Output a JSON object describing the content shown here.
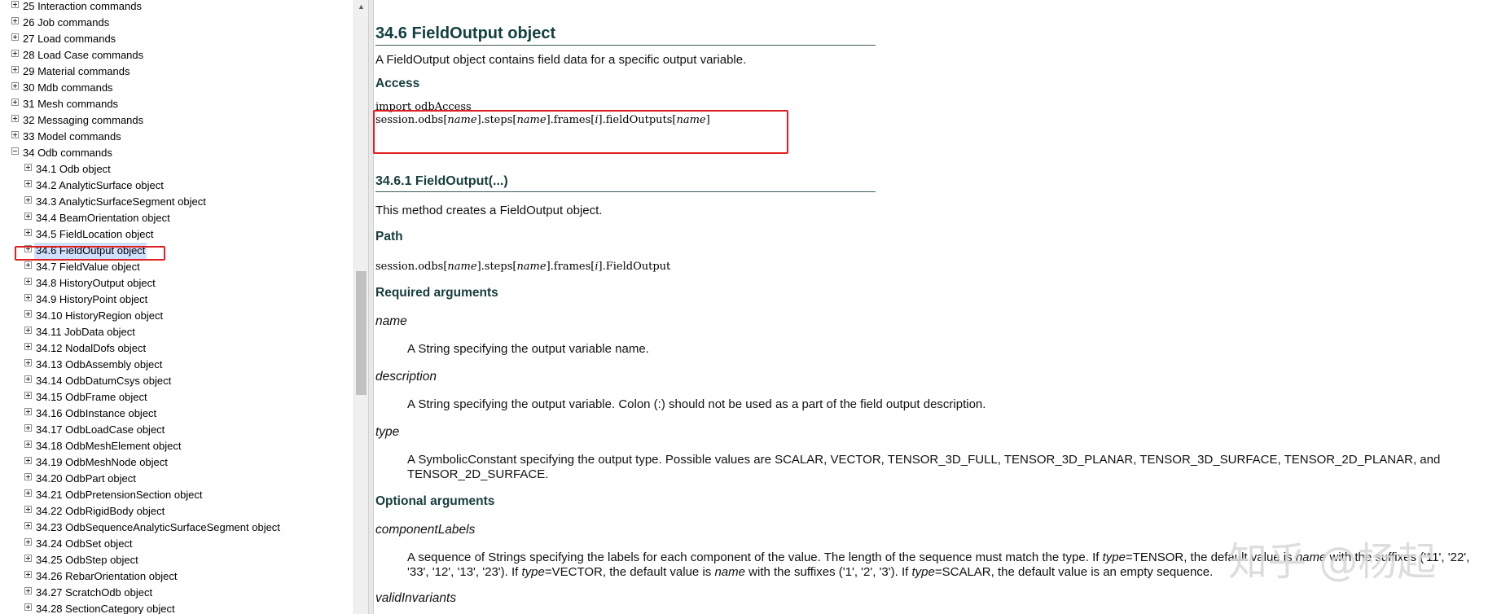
{
  "toc": {
    "items": [
      {
        "label": "25 Interaction commands",
        "level": 0,
        "expander": "plus"
      },
      {
        "label": "26 Job commands",
        "level": 0,
        "expander": "plus"
      },
      {
        "label": "27 Load commands",
        "level": 0,
        "expander": "plus"
      },
      {
        "label": "28 Load Case commands",
        "level": 0,
        "expander": "plus"
      },
      {
        "label": "29 Material commands",
        "level": 0,
        "expander": "plus"
      },
      {
        "label": "30 Mdb commands",
        "level": 0,
        "expander": "plus"
      },
      {
        "label": "31 Mesh commands",
        "level": 0,
        "expander": "plus"
      },
      {
        "label": "32 Messaging commands",
        "level": 0,
        "expander": "plus"
      },
      {
        "label": "33 Model commands",
        "level": 0,
        "expander": "plus"
      },
      {
        "label": "34 Odb commands",
        "level": 0,
        "expander": "minus"
      },
      {
        "label": "34.1 Odb object",
        "level": 1,
        "expander": "plus"
      },
      {
        "label": "34.2 AnalyticSurface object",
        "level": 1,
        "expander": "plus"
      },
      {
        "label": "34.3 AnalyticSurfaceSegment object",
        "level": 1,
        "expander": "plus"
      },
      {
        "label": "34.4 BeamOrientation object",
        "level": 1,
        "expander": "plus"
      },
      {
        "label": "34.5 FieldLocation object",
        "level": 1,
        "expander": "plus"
      },
      {
        "label": "34.6 FieldOutput object",
        "level": 1,
        "expander": "plus",
        "selected": true
      },
      {
        "label": "34.7 FieldValue object",
        "level": 1,
        "expander": "plus"
      },
      {
        "label": "34.8 HistoryOutput object",
        "level": 1,
        "expander": "plus"
      },
      {
        "label": "34.9 HistoryPoint object",
        "level": 1,
        "expander": "plus"
      },
      {
        "label": "34.10 HistoryRegion object",
        "level": 1,
        "expander": "plus"
      },
      {
        "label": "34.11 JobData object",
        "level": 1,
        "expander": "plus"
      },
      {
        "label": "34.12 NodalDofs object",
        "level": 1,
        "expander": "plus"
      },
      {
        "label": "34.13 OdbAssembly object",
        "level": 1,
        "expander": "plus"
      },
      {
        "label": "34.14 OdbDatumCsys object",
        "level": 1,
        "expander": "plus"
      },
      {
        "label": "34.15 OdbFrame object",
        "level": 1,
        "expander": "plus"
      },
      {
        "label": "34.16 OdbInstance object",
        "level": 1,
        "expander": "plus"
      },
      {
        "label": "34.17 OdbLoadCase object",
        "level": 1,
        "expander": "plus"
      },
      {
        "label": "34.18 OdbMeshElement object",
        "level": 1,
        "expander": "plus"
      },
      {
        "label": "34.19 OdbMeshNode object",
        "level": 1,
        "expander": "plus"
      },
      {
        "label": "34.20 OdbPart object",
        "level": 1,
        "expander": "plus"
      },
      {
        "label": "34.21 OdbPretensionSection object",
        "level": 1,
        "expander": "plus"
      },
      {
        "label": "34.22 OdbRigidBody object",
        "level": 1,
        "expander": "plus"
      },
      {
        "label": "34.23 OdbSequenceAnalyticSurfaceSegment object",
        "level": 1,
        "expander": "plus"
      },
      {
        "label": "34.24 OdbSet object",
        "level": 1,
        "expander": "plus"
      },
      {
        "label": "34.25 OdbStep object",
        "level": 1,
        "expander": "plus"
      },
      {
        "label": "34.26 RebarOrientation object",
        "level": 1,
        "expander": "plus"
      },
      {
        "label": "34.27 ScratchOdb object",
        "level": 1,
        "expander": "plus"
      },
      {
        "label": "34.28 SectionCategory object",
        "level": 1,
        "expander": "plus"
      }
    ]
  },
  "content": {
    "title": "34.6 FieldOutput object",
    "intro": "A FieldOutput object contains field data for a specific output variable.",
    "access_heading": "Access",
    "access_line1": "import odbAccess",
    "access_line2": {
      "a": "session.odbs[",
      "b": "name",
      "c": "].steps[",
      "d": "name",
      "e": "].frames[",
      "f": "i",
      "g": "].fieldOutputs[",
      "h": "name",
      "i": "]"
    },
    "method_heading": "34.6.1 FieldOutput(...)",
    "method_desc": "This method creates a FieldOutput object.",
    "path_heading": "Path",
    "path": {
      "a": "session.odbs[",
      "b": "name",
      "c": "].steps[",
      "d": "name",
      "e": "].frames[",
      "f": "i",
      "g": "].FieldOutput"
    },
    "required_heading": "Required arguments",
    "args": [
      {
        "name": "name",
        "desc": "A String specifying the output variable name."
      },
      {
        "name": "description",
        "desc": "A String specifying the output variable. Colon (:) should not be used as a part of the field output description."
      },
      {
        "name": "type",
        "desc": "A SymbolicConstant specifying the output type. Possible values are SCALAR, VECTOR, TENSOR_3D_FULL, TENSOR_3D_PLANAR, TENSOR_3D_SURFACE, TENSOR_2D_PLANAR, and TENSOR_2D_SURFACE."
      }
    ],
    "optional_heading": "Optional arguments",
    "opt_args": [
      {
        "name": "componentLabels",
        "desc": {
          "p1": "A sequence of Strings specifying the labels for each component of the value. The length of the sequence must match the type. If ",
          "t1": "type",
          "p2": "=TENSOR, the default value is ",
          "n1": "name",
          "p3": " with the suffixes ('11', '22', '33', '12', '13', '23'). If ",
          "t2": "type",
          "p4": "=VECTOR, the default value is ",
          "n2": "name",
          "p5": " with the suffixes ('1', '2', '3'). If ",
          "t3": "type",
          "p6": "=SCALAR, the default value is an empty sequence."
        }
      },
      {
        "name": "validInvariants"
      }
    ]
  },
  "watermark": "知乎 @杨起",
  "colors": {
    "highlight_box": "#e02020",
    "heading": "#163c3c",
    "selected_bg": "#cfe0ff"
  }
}
